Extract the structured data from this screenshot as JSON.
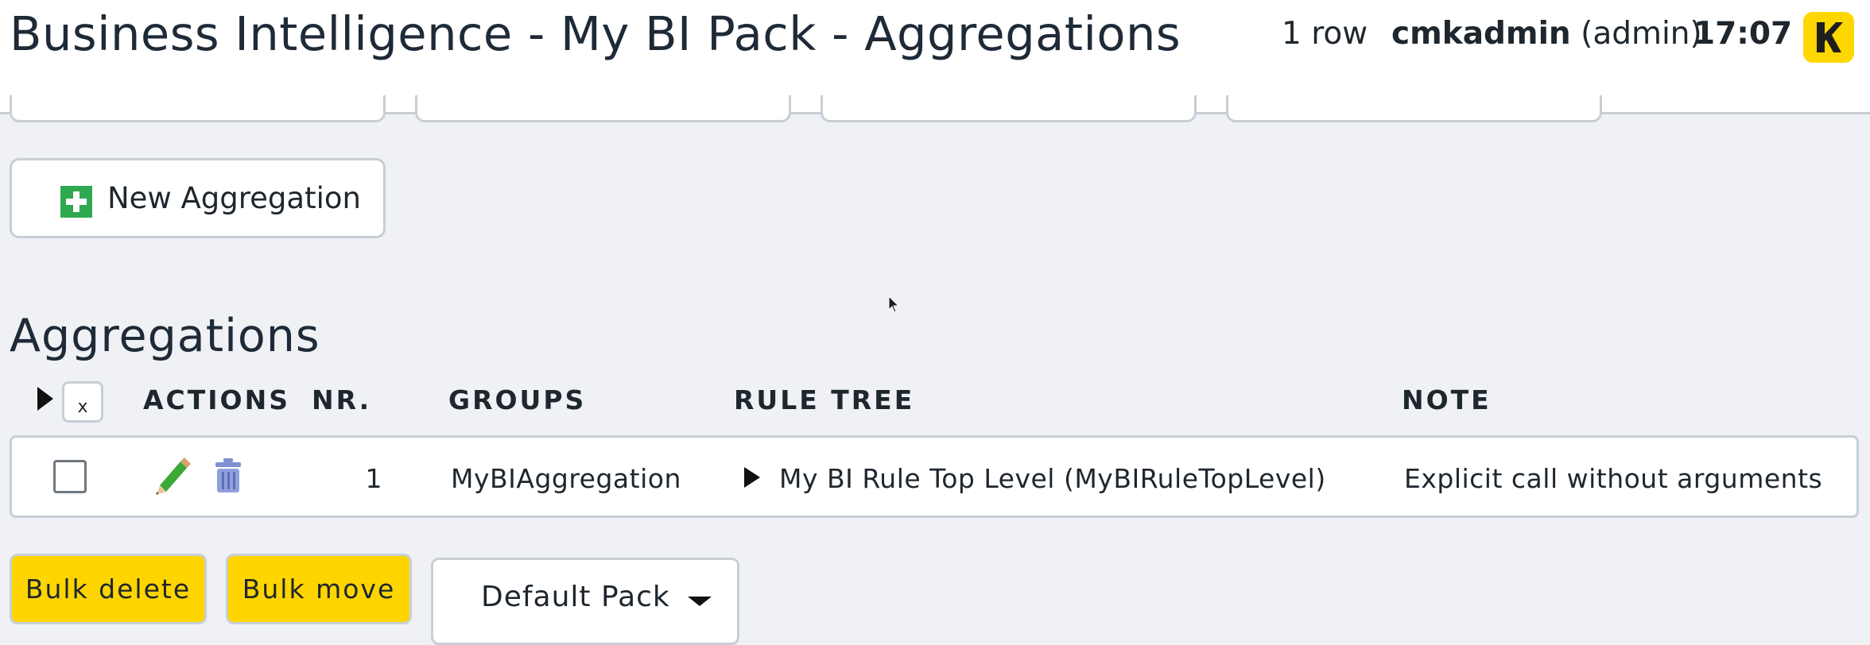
{
  "header": {
    "title": "Business Intelligence - My BI Pack - Aggregations",
    "row_count": "1 row",
    "username": "cmkadmin",
    "role": "(admin)",
    "time": "17:07",
    "logo_icon": "checkmk-logo-icon",
    "logo_color": "#ffd700"
  },
  "toolbar": {
    "new_aggregation_label": "New Aggregation",
    "new_aggregation_icon": "plus-icon"
  },
  "section": {
    "title": "Aggregations"
  },
  "table": {
    "select_toggle_label": "x",
    "columns": [
      "ACTIONS",
      "NR.",
      "GROUPS",
      "RULE TREE",
      "NOTE"
    ],
    "rows": [
      {
        "checked": false,
        "actions": [
          "edit-icon",
          "delete-icon"
        ],
        "nr": "1",
        "groups": "MyBIAggregation",
        "rule_tree": "My BI Rule Top Level (MyBIRuleTopLevel)",
        "note": "Explicit call without arguments"
      }
    ]
  },
  "bulk": {
    "delete_label": "Bulk delete",
    "move_label": "Bulk move",
    "target_pack_selected": "Default Pack",
    "button_color": "#ffd500"
  }
}
